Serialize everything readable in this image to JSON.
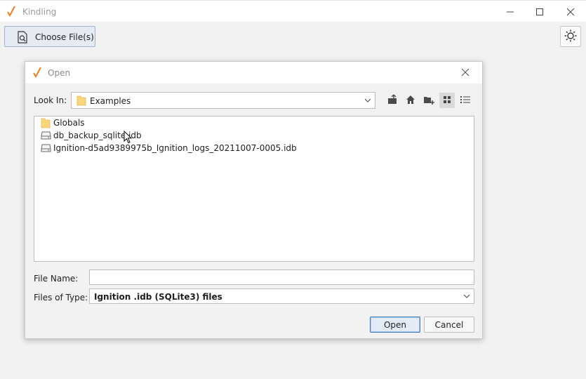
{
  "app": {
    "title": "Kindling",
    "choose_button": "Choose File(s)",
    "accent": "#f07d1e"
  },
  "dialog": {
    "title": "Open",
    "look_in_label": "Look In:",
    "look_in_value": "Examples",
    "files": [
      {
        "name": "Globals",
        "icon": "folder-icon"
      },
      {
        "name": "db_backup_sqlite.idb",
        "icon": "drive-icon"
      },
      {
        "name": "Ignition-d5ad9389975b_Ignition_logs_20211007-0005.idb",
        "icon": "drive-icon"
      }
    ],
    "file_name_label": "File Name:",
    "file_name_value": "",
    "files_of_type_label": "Files of Type:",
    "files_of_type_value": "Ignition .idb (SQLite3) files",
    "open_button": "Open",
    "cancel_button": "Cancel"
  }
}
